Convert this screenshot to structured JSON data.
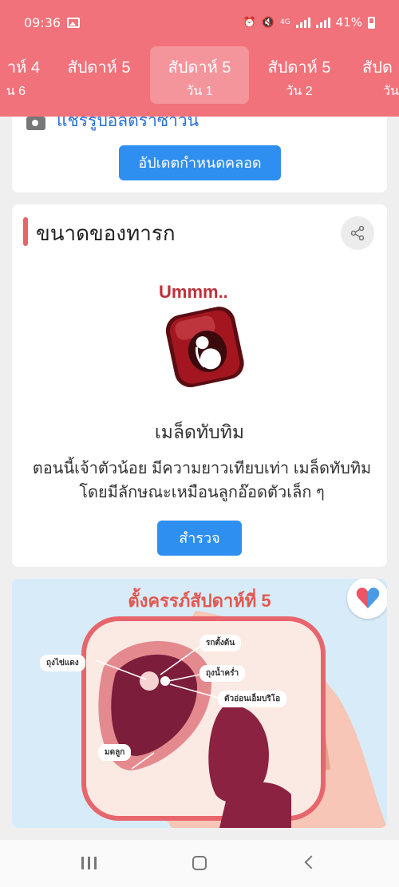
{
  "status_bar": {
    "time": "09:36",
    "battery_percent": "41%",
    "network_label": "4G"
  },
  "tabs": [
    {
      "week": "าห์ 4",
      "day": "น 6",
      "active": false
    },
    {
      "week": "สัปดาห์ 5",
      "day": "",
      "active": false
    },
    {
      "week": "สัปดาห์ 5",
      "day": "วัน 1",
      "active": true
    },
    {
      "week": "สัปดาห์ 5",
      "day": "วัน 2",
      "active": false
    },
    {
      "week": "สัปด",
      "day": "วัน",
      "active": false
    }
  ],
  "due_date_card": {
    "share_ultrasound_link": "แชร์รูปอัลตร้าซาวน์",
    "update_due_date_button": "อัปเดตกำหนดคลอด"
  },
  "baby_size_card": {
    "section_title": "ขนาดของทารก",
    "sticker_text": "Ummm..",
    "fruit_name": "เมล็ดทับทิม",
    "description": "ตอนนี้เจ้าตัวน้อย มีความยาวเทียบเท่า เมล็ดทับทิม โดยมีลักษณะเหมือนลูกอ๊อดตัวเล็ก ๆ",
    "explore_button": "สำรวจ"
  },
  "illustration_card": {
    "title": "ตั้งครรภ์สัปดาห์ที่ 5",
    "labels": {
      "yolk_sac": "ถุงไข่แดง",
      "umbilical_cord": "รกตั้งต้น",
      "amniotic_sac": "ถุงน้ำคร่ำ",
      "embryo": "ตัวอ่อนเอ็มบริโอ",
      "uterus": "มดลูก"
    }
  },
  "colors": {
    "header": "#f1727a",
    "accent_blue": "#2f8ff0",
    "section_bar": "#e8636b",
    "illustration_bg": "#d7ecf8"
  }
}
